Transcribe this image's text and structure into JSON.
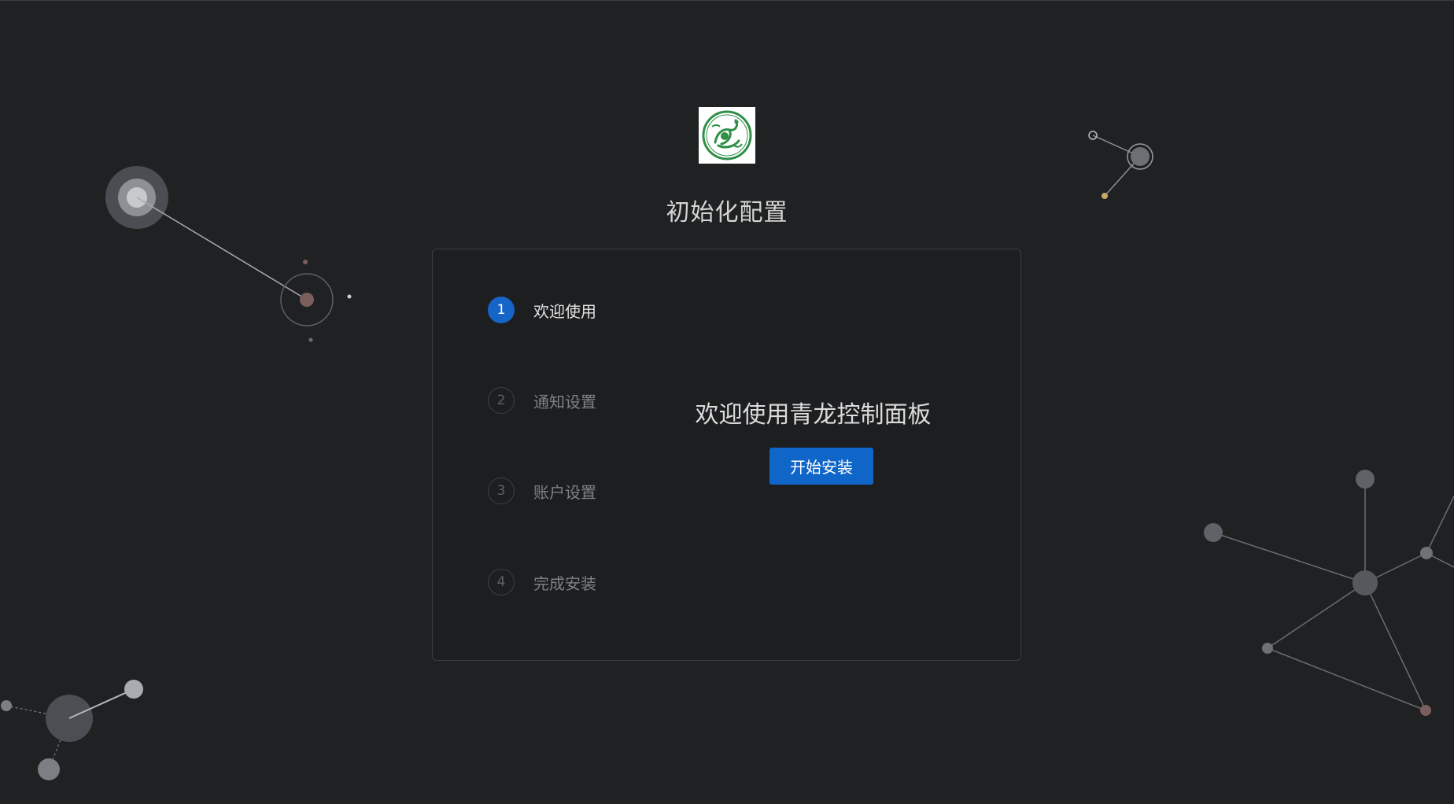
{
  "page": {
    "title": "初始化配置"
  },
  "steps": [
    {
      "index": "1",
      "label": "欢迎使用",
      "active": true
    },
    {
      "index": "2",
      "label": "通知设置",
      "active": false
    },
    {
      "index": "3",
      "label": "账户设置",
      "active": false
    },
    {
      "index": "4",
      "label": "完成安装",
      "active": false
    }
  ],
  "content": {
    "heading": "欢迎使用青龙控制面板",
    "button_label": "开始安装"
  },
  "colors": {
    "background": "#1f2122",
    "accent": "#1564c8",
    "logo_green": "#2f8f47"
  },
  "icons": {
    "logo": "qinglong-dragon-logo"
  }
}
